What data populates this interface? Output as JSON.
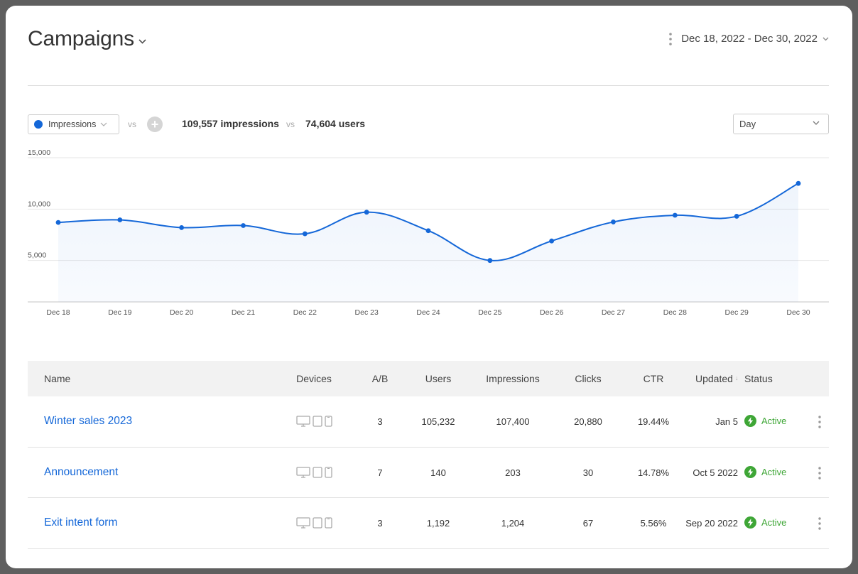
{
  "header": {
    "title": "Campaigns",
    "date_range": "Dec 18, 2022 - Dec 30, 2022"
  },
  "controls": {
    "metric": "Impressions",
    "metric_color": "#1467d8",
    "vs": "vs",
    "add_symbol": "+",
    "stat_impressions": "109,557 impressions",
    "stat_users": "74,604 users",
    "period": "Day"
  },
  "chart_data": {
    "type": "line",
    "x": [
      "Dec 18",
      "Dec 19",
      "Dec 20",
      "Dec 21",
      "Dec 22",
      "Dec 23",
      "Dec 24",
      "Dec 25",
      "Dec 26",
      "Dec 27",
      "Dec 28",
      "Dec 29",
      "Dec 30"
    ],
    "series": [
      {
        "name": "Impressions",
        "values": [
          8700,
          8950,
          8200,
          8400,
          7600,
          9700,
          7900,
          5000,
          6900,
          8750,
          9400,
          9300,
          12500
        ]
      }
    ],
    "yticks": [
      "15,000",
      "10,000",
      "5,000"
    ],
    "ytick_values": [
      15000,
      10000,
      5000
    ],
    "ylim": [
      0,
      15000
    ],
    "grid": true,
    "color": "#1467d8"
  },
  "table": {
    "columns": {
      "name": "Name",
      "devices": "Devices",
      "ab": "A/B",
      "users": "Users",
      "impressions": "Impressions",
      "clicks": "Clicks",
      "ctr": "CTR",
      "updated": "Updated",
      "status": "Status"
    },
    "sort_indicator": "↓",
    "rows": [
      {
        "name": "Winter sales 2023",
        "ab": "3",
        "users": "105,232",
        "impressions": "107,400",
        "clicks": "20,880",
        "ctr": "19.44%",
        "updated": "Jan 5",
        "status": "Active"
      },
      {
        "name": "Announcement",
        "ab": "7",
        "users": "140",
        "impressions": "203",
        "clicks": "30",
        "ctr": "14.78%",
        "updated": "Oct 5 2022",
        "status": "Active"
      },
      {
        "name": "Exit intent form",
        "ab": "3",
        "users": "1,192",
        "impressions": "1,204",
        "clicks": "67",
        "ctr": "5.56%",
        "updated": "Sep 20 2022",
        "status": "Active"
      }
    ],
    "status_color": "#3ea636"
  }
}
